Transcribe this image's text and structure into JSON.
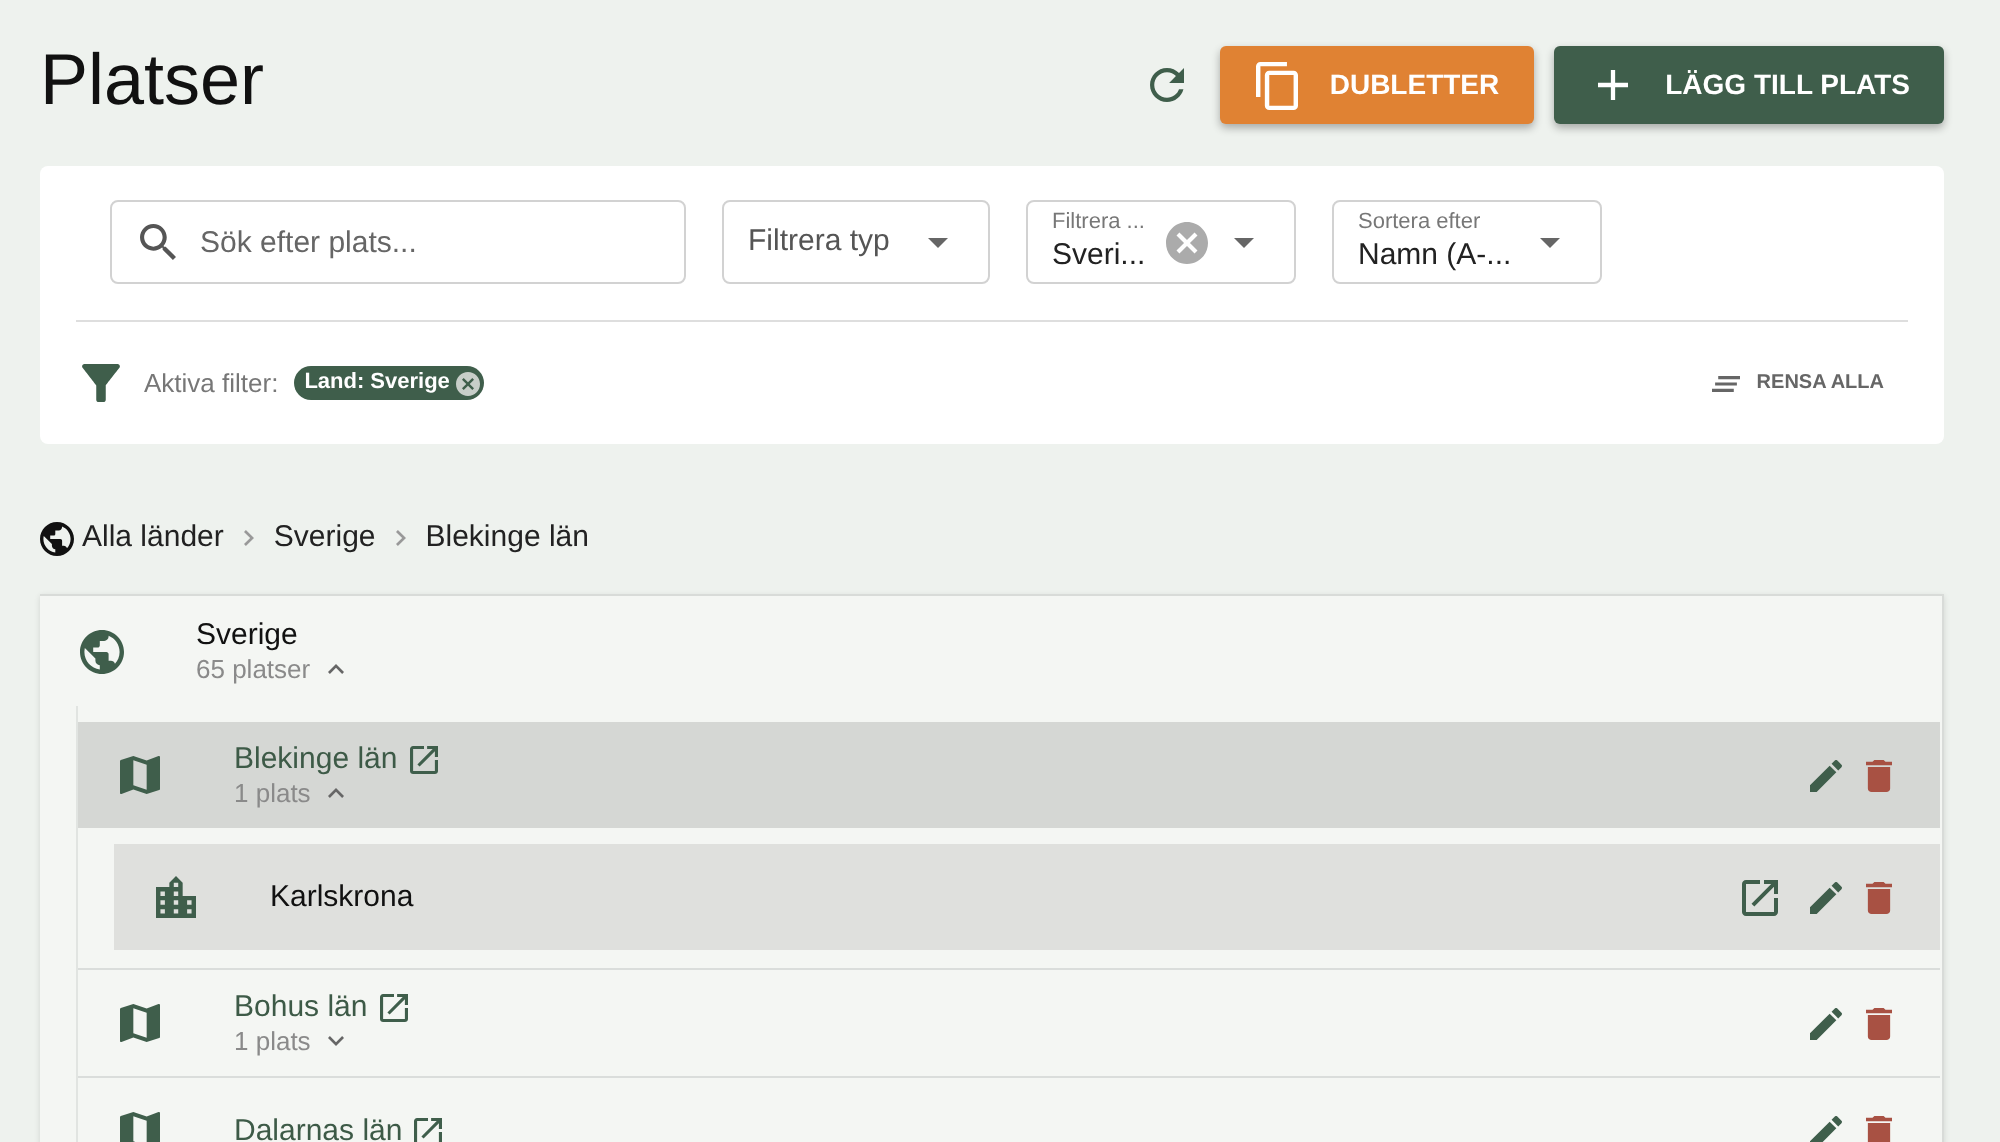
{
  "page": {
    "title": "Platser"
  },
  "actions": [
    {
      "kind": "duplicates",
      "label": "DUBLETTER"
    },
    {
      "kind": "add",
      "label": "LÄGG TILL PLATS"
    }
  ],
  "filters": {
    "search": {
      "placeholder": "Sök efter plats..."
    },
    "selects": [
      {
        "placeholder": "Filtrera typ",
        "clearable": false
      },
      {
        "label": "Filtrera ...",
        "value": "Sveri...",
        "clearable": true
      },
      {
        "label": "Sortera efter",
        "value": "Namn (A-...",
        "clearable": false
      }
    ],
    "active_label": "Aktiva filter:",
    "chips": [
      {
        "label": "Land: Sverige"
      }
    ],
    "clear_all": "RENSA ALLA"
  },
  "breadcrumb": [
    {
      "label": "Alla länder"
    },
    {
      "label": "Sverige"
    },
    {
      "label": "Blekinge län"
    }
  ],
  "tree": [
    {
      "kind": "country",
      "name": "Sverige",
      "count": "65 platser",
      "expanded": true,
      "children": [
        {
          "kind": "region",
          "name": "Blekinge län",
          "count": "1 plats",
          "expanded": true,
          "selected": true,
          "children": [
            {
              "kind": "city",
              "name": "Karlskrona"
            }
          ]
        },
        {
          "kind": "region",
          "name": "Bohus län",
          "count": "1 plats",
          "expanded": false,
          "selected": false
        },
        {
          "kind": "region",
          "name": "Dalarnas län",
          "selected": false
        }
      ]
    }
  ]
}
